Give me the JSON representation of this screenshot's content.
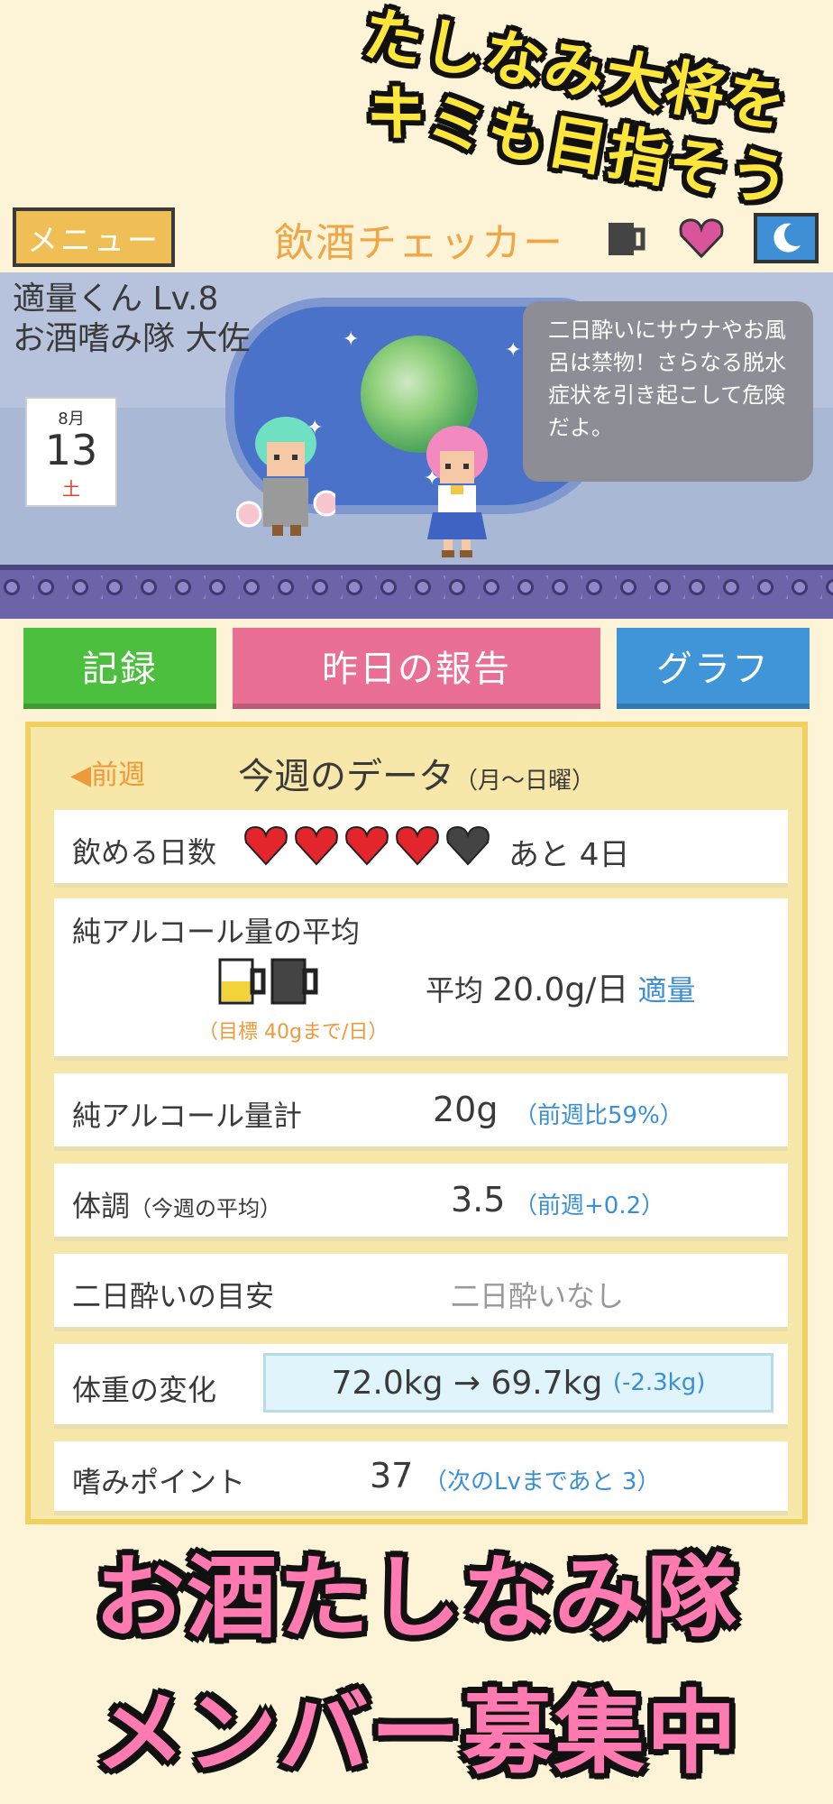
{
  "promo": {
    "top_line1": "たしなみ大将を",
    "top_line2": "キミも目指そう",
    "bottom_line1": "お酒たしなみ隊",
    "bottom_line2": "メンバー募集中"
  },
  "header": {
    "menu_label": "メニュー",
    "title": "飲酒チェッカー",
    "icons": [
      "mug-icon",
      "heart-icon",
      "moon-icon"
    ]
  },
  "scene": {
    "player_line1": "適量くん Lv.8",
    "player_line2": "お酒嗜み隊 大佐",
    "calendar": {
      "month": "8月",
      "day": "13",
      "weekday": "土"
    },
    "speech": "二日酔いにサウナやお風呂は禁物！さらなる脱水症状を引き起こして危険だよ。"
  },
  "tabs": {
    "record": "記録",
    "report": "昨日の報告",
    "graph": "グラフ"
  },
  "colors": {
    "record_tab": "#4cbf3f",
    "report_tab": "#ea6f95",
    "graph_tab": "#3f95d8",
    "accent_blue": "#3a8fd6",
    "accent_orange": "#ef9a3a",
    "promo_pink": "#ff7ab0",
    "promo_yellow": "#ffe63a"
  },
  "week": {
    "prev_label": "◀前週",
    "title": "今週のデータ",
    "subtitle": "（月〜日曜）"
  },
  "drink_days": {
    "label": "飲める日数",
    "hearts_filled": 4,
    "hearts_total": 5,
    "remaining": "あと 4日"
  },
  "avg_alcohol": {
    "label": "純アルコール量の平均",
    "mugs_filled": 0.5,
    "mugs_total": 2,
    "target_note": "（目標 40gまで/日）",
    "avg_prefix": "平均 ",
    "avg_value": "20.0g/日",
    "status": "適量"
  },
  "total_alcohol": {
    "label": "純アルコール量計",
    "value": "20g",
    "compare": "（前週比59%）"
  },
  "condition": {
    "label": "体調",
    "sub": "（今週の平均）",
    "value": "3.5",
    "compare": "（前週+0.2）"
  },
  "hangover": {
    "label": "二日酔いの目安",
    "value": "二日酔いなし"
  },
  "weight": {
    "label": "体重の変化",
    "value": "72.0kg → 69.7kg",
    "diff": "(-2.3kg)"
  },
  "points": {
    "label": "嗜みポイント",
    "value": "37",
    "next": "（次のLvまであと 3）"
  }
}
